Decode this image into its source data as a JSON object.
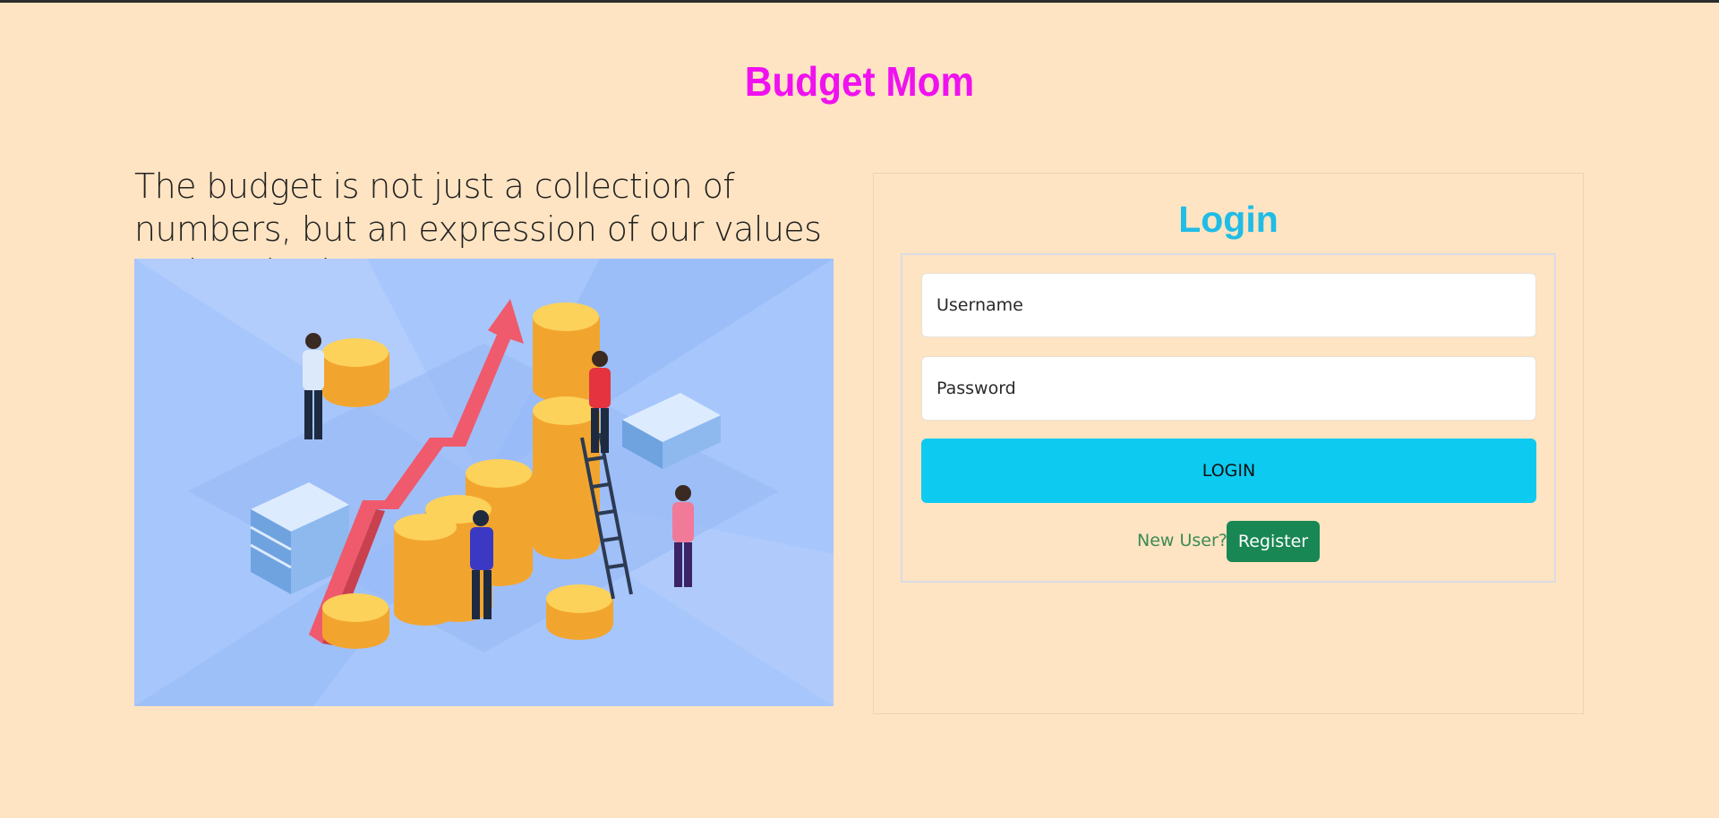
{
  "header": {
    "brand_title": "Budget Mom",
    "brand_color": "#F011F0"
  },
  "hero": {
    "quote": "The budget is not just a collection of numbers, but an expression of our values and aspirations.",
    "image_subject": "budget-growth-illustration"
  },
  "login": {
    "title": "Login",
    "username_placeholder": "Username",
    "password_placeholder": "Password",
    "login_button": "LOGIN",
    "new_user_text": "New User?",
    "register_button": "Register"
  },
  "colors": {
    "background": "#FEE4C2",
    "login_title": "#1FBCE6",
    "login_button": "#0DCAF0",
    "register_button": "#198754",
    "new_user_text": "#3C8A55"
  }
}
